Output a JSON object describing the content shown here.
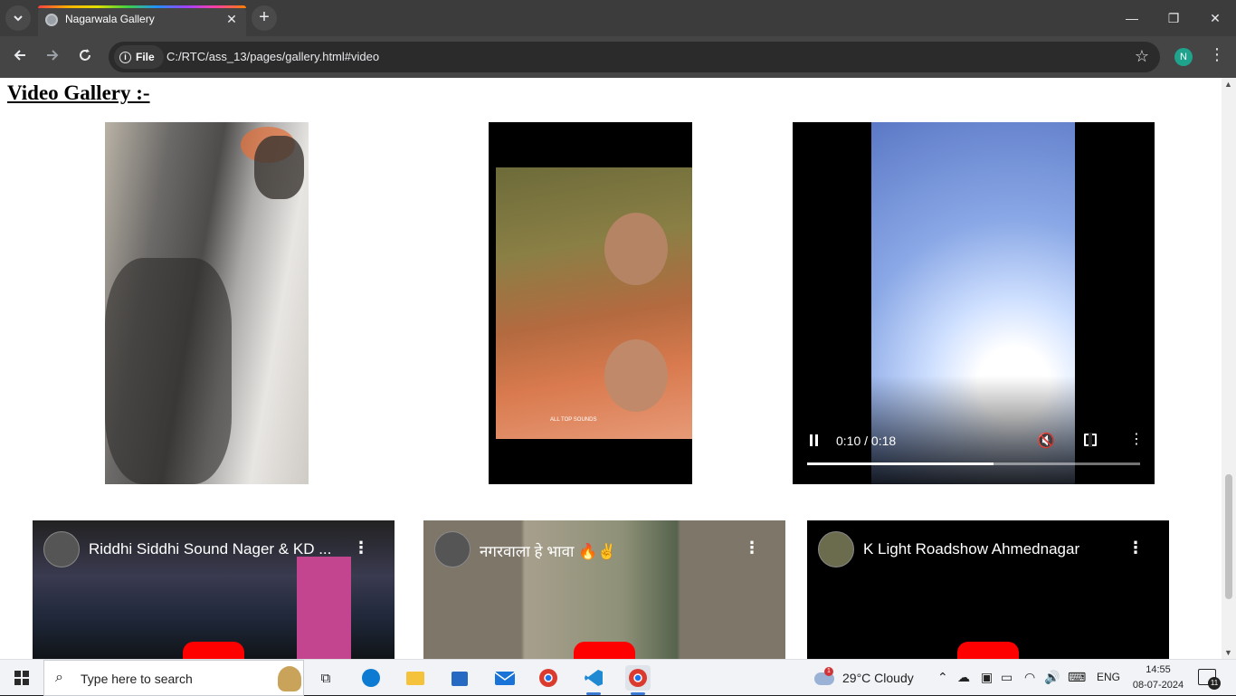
{
  "browser": {
    "tab_title": "Nagarwala Gallery",
    "tab_close": "✕",
    "new_tab": "+",
    "chip_label": "File",
    "url": "C:/RTC/ass_13/pages/gallery.html#video",
    "profile_initial": "N",
    "window_minimize": "—",
    "window_restore": "❐",
    "window_close": "✕"
  },
  "page": {
    "heading": "Video Gallery :-",
    "video_player": {
      "time": "0:10 / 0:18",
      "progress": 0.56
    },
    "youtube_embeds": [
      {
        "title": "Riddhi Siddhi Sound Nager & KD ..."
      },
      {
        "title": "नगरवाला हे भावा 🔥✌️"
      },
      {
        "title": "K Light Roadshow Ahmednagar"
      }
    ],
    "video2_watermark": "ALL TOP SOUNDS"
  },
  "taskbar": {
    "search_placeholder": "Type here to search",
    "weather_badge": "1",
    "weather": "29°C  Cloudy",
    "language": "ENG",
    "time": "14:55",
    "date": "08-07-2024",
    "notification_count": "11",
    "colors": {
      "edge": "#0c7bd1",
      "explorer": "#f4c23b",
      "store": "#2569c3",
      "mail": "#1a73d6",
      "chrome": "#db3b2f",
      "vscode": "#1f8ad2"
    }
  }
}
